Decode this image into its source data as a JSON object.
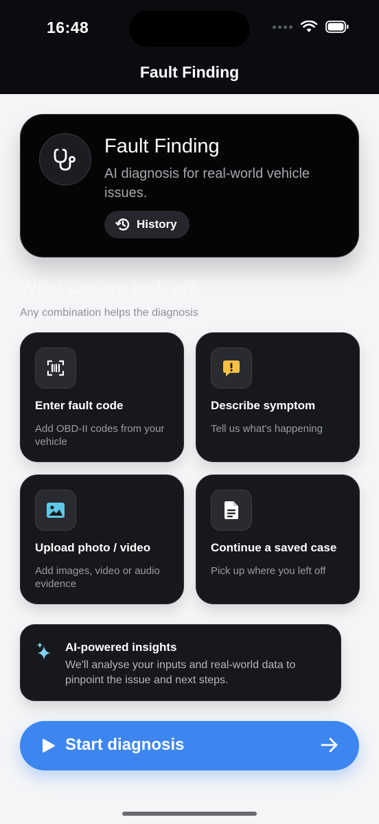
{
  "status_bar": {
    "time": "16:48",
    "icons": [
      "signal-dots-icon",
      "wifi-icon",
      "battery-icon"
    ]
  },
  "nav": {
    "title": "Fault Finding"
  },
  "hero": {
    "icon": "stethoscope-icon",
    "title": "Fault Finding",
    "subtitle": "AI diagnosis for real-world vehicle issues.",
    "history_icon": "history-clock-icon",
    "history_label": "History"
  },
  "section": {
    "title": "What can we look at?",
    "subtitle": "Any combination helps the diagnosis"
  },
  "options": [
    {
      "icon": "barcode-scan-icon",
      "title": "Enter fault code",
      "subtitle": "Add OBD-II codes from your vehicle"
    },
    {
      "icon": "alert-message-icon",
      "title": "Describe symptom",
      "subtitle": "Tell us what's happening"
    },
    {
      "icon": "image-icon",
      "title": "Upload photo / video",
      "subtitle": "Add images, video or audio evidence"
    },
    {
      "icon": "document-icon",
      "title": "Continue a saved case",
      "subtitle": "Pick up where you left off"
    }
  ],
  "insight": {
    "icon": "sparkles-icon",
    "title": "AI-powered insights",
    "text": "We'll analyse your inputs and real-world data to pinpoint the issue and next steps."
  },
  "cta": {
    "label": "Start diagnosis",
    "icon_left": "play-icon",
    "icon_right": "arrow-right-icon"
  },
  "colors": {
    "accent": "#3d86f0",
    "card_bg": "#17181c",
    "symptom_icon": "#f5c142",
    "image_icon": "#5ec8e8",
    "sparkle_icon": "#7fd0f0"
  }
}
